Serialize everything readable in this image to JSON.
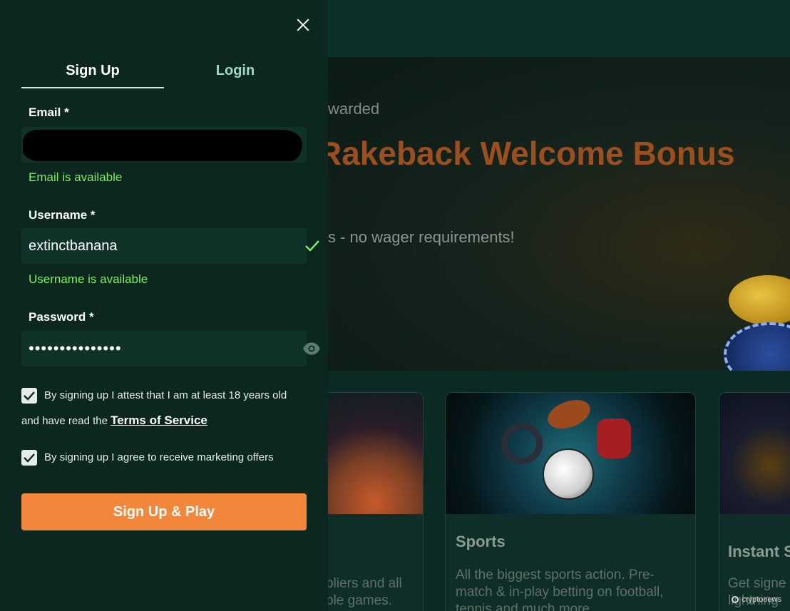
{
  "modal": {
    "tabs": {
      "signup": "Sign Up",
      "login": "Login"
    },
    "email": {
      "label": "Email *",
      "value": "",
      "status": "Email is available"
    },
    "username": {
      "label": "Username *",
      "value": "extinctbanana",
      "status": "Username is available"
    },
    "password": {
      "label": "Password *",
      "value": "•••••••••••••••"
    },
    "age_consent": {
      "line1": "By signing up I attest that I am at least 18 years old",
      "line2_prefix": "and have read the ",
      "tos_link": "Terms of Service",
      "checked": true
    },
    "marketing_consent": {
      "text": "By signing up I agree to receive marketing offers",
      "checked": true
    },
    "submit_label": "Sign Up & Play"
  },
  "background": {
    "hero": {
      "eyebrow": "warded",
      "title": "Rakeback Welcome Bonus",
      "subtitle": "s - no wager requirements!"
    },
    "cards": [
      {
        "title": "",
        "description": "pliers and all\nble games."
      },
      {
        "title": "Sports",
        "description": "All the biggest sports action. Pre-match & in-play betting on football, tennis and much more"
      },
      {
        "title": "Instant S",
        "description": "Get signe\nlightning"
      }
    ],
    "watermark": "cryptonews"
  },
  "colors": {
    "panel_bg": "#0c2620",
    "accent_orange": "#f2863a",
    "success_green": "#7cf05a",
    "login_tab": "#9edbc6",
    "hero_title": "#9c4f1e"
  }
}
